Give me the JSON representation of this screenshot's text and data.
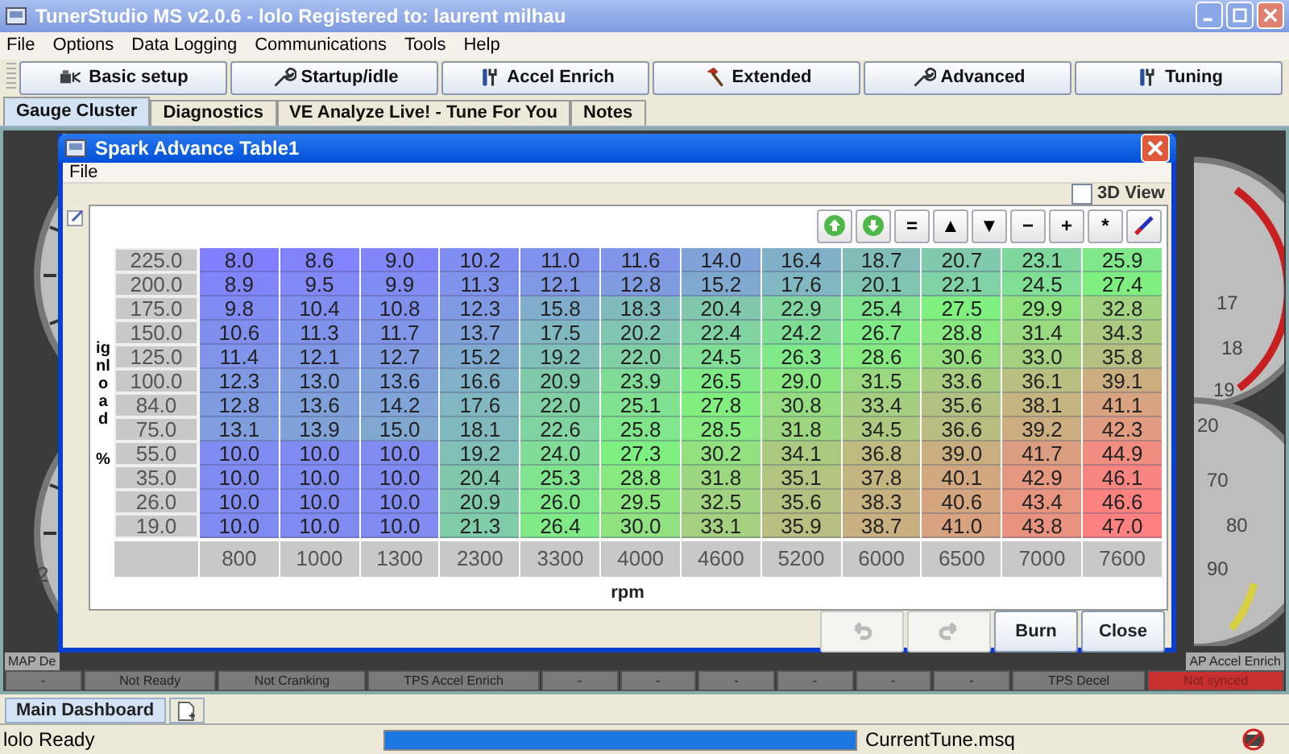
{
  "window": {
    "title": "TunerStudio MS v2.0.6 - lolo Registered to: laurent milhau"
  },
  "menu": [
    "File",
    "Options",
    "Data Logging",
    "Communications",
    "Tools",
    "Help"
  ],
  "toolbar": [
    {
      "label": "Basic setup",
      "kind": "plug"
    },
    {
      "label": "Startup/idle",
      "kind": "wrench"
    },
    {
      "label": "Accel Enrich",
      "kind": "tools"
    },
    {
      "label": "Extended",
      "kind": "hammer"
    },
    {
      "label": "Advanced",
      "kind": "wrench"
    },
    {
      "label": "Tuning",
      "kind": "tools"
    }
  ],
  "tabs": [
    {
      "label": "Gauge Cluster",
      "selected": true
    },
    {
      "label": "Diagnostics",
      "selected": false
    },
    {
      "label": "VE Analyze Live! - Tune For You",
      "selected": false
    },
    {
      "label": "Notes",
      "selected": false
    }
  ],
  "gauges": {
    "left_label": "2",
    "right_top_labels": [
      "17",
      "18",
      "19",
      "20"
    ],
    "right_bottom_labels": [
      "70",
      "80",
      "90"
    ]
  },
  "gauge_captions": {
    "left": "MAP De",
    "right": "AP Accel Enrich"
  },
  "indicators": [
    {
      "label": "-",
      "on": false
    },
    {
      "label": "Not Ready",
      "on": false
    },
    {
      "label": "Not Cranking",
      "on": false
    },
    {
      "label": "TPS Accel Enrich",
      "on": false
    },
    {
      "label": "-",
      "on": false
    },
    {
      "label": "-",
      "on": false
    },
    {
      "label": "-",
      "on": false
    },
    {
      "label": "-",
      "on": false
    },
    {
      "label": "-",
      "on": false
    },
    {
      "label": "-",
      "on": false
    },
    {
      "label": "TPS Decel",
      "on": false
    },
    {
      "label": "Not synced",
      "on": true
    }
  ],
  "dialog": {
    "title": "Spark Advance Table1",
    "menu": [
      "File"
    ],
    "view_3d": {
      "label": "3D View",
      "checked": false
    },
    "tools": [
      {
        "kind": "up"
      },
      {
        "kind": "down"
      },
      {
        "kind": "text",
        "label": "="
      },
      {
        "kind": "text",
        "label": "▲"
      },
      {
        "kind": "text",
        "label": "▼"
      },
      {
        "kind": "text",
        "label": "−"
      },
      {
        "kind": "text",
        "label": "+"
      },
      {
        "kind": "text",
        "label": "*"
      },
      {
        "kind": "pen"
      }
    ],
    "y_axis_label": "ignload",
    "y_axis_unit": "%",
    "x_axis_label": "rpm",
    "rows": [
      {
        "load": "225.0",
        "values": [
          "8.0",
          "8.6",
          "9.0",
          "10.2",
          "11.0",
          "11.6",
          "14.0",
          "16.4",
          "18.7",
          "20.7",
          "23.1",
          "25.9"
        ]
      },
      {
        "load": "200.0",
        "values": [
          "8.9",
          "9.5",
          "9.9",
          "11.3",
          "12.1",
          "12.8",
          "15.2",
          "17.6",
          "20.1",
          "22.1",
          "24.5",
          "27.4"
        ]
      },
      {
        "load": "175.0",
        "values": [
          "9.8",
          "10.4",
          "10.8",
          "12.3",
          "15.8",
          "18.3",
          "20.4",
          "22.9",
          "25.4",
          "27.5",
          "29.9",
          "32.8"
        ]
      },
      {
        "load": "150.0",
        "values": [
          "10.6",
          "11.3",
          "11.7",
          "13.7",
          "17.5",
          "20.2",
          "22.4",
          "24.2",
          "26.7",
          "28.8",
          "31.4",
          "34.3"
        ]
      },
      {
        "load": "125.0",
        "values": [
          "11.4",
          "12.1",
          "12.7",
          "15.2",
          "19.2",
          "22.0",
          "24.5",
          "26.3",
          "28.6",
          "30.6",
          "33.0",
          "35.8"
        ]
      },
      {
        "load": "100.0",
        "values": [
          "12.3",
          "13.0",
          "13.6",
          "16.6",
          "20.9",
          "23.9",
          "26.5",
          "29.0",
          "31.5",
          "33.6",
          "36.1",
          "39.1"
        ]
      },
      {
        "load": "84.0",
        "values": [
          "12.8",
          "13.6",
          "14.2",
          "17.6",
          "22.0",
          "25.1",
          "27.8",
          "30.8",
          "33.4",
          "35.6",
          "38.1",
          "41.1"
        ]
      },
      {
        "load": "75.0",
        "values": [
          "13.1",
          "13.9",
          "15.0",
          "18.1",
          "22.6",
          "25.8",
          "28.5",
          "31.8",
          "34.5",
          "36.6",
          "39.2",
          "42.3"
        ]
      },
      {
        "load": "55.0",
        "values": [
          "10.0",
          "10.0",
          "10.0",
          "19.2",
          "24.0",
          "27.3",
          "30.2",
          "34.1",
          "36.8",
          "39.0",
          "41.7",
          "44.9"
        ]
      },
      {
        "load": "35.0",
        "values": [
          "10.0",
          "10.0",
          "10.0",
          "20.4",
          "25.3",
          "28.8",
          "31.8",
          "35.1",
          "37.8",
          "40.1",
          "42.9",
          "46.1"
        ]
      },
      {
        "load": "26.0",
        "values": [
          "10.0",
          "10.0",
          "10.0",
          "20.9",
          "26.0",
          "29.5",
          "32.5",
          "35.6",
          "38.3",
          "40.6",
          "43.4",
          "46.6"
        ]
      },
      {
        "load": "19.0",
        "values": [
          "10.0",
          "10.0",
          "10.0",
          "21.3",
          "26.4",
          "30.0",
          "33.1",
          "35.9",
          "38.7",
          "41.0",
          "43.8",
          "47.0"
        ]
      }
    ],
    "rpm": [
      "800",
      "1000",
      "1300",
      "2300",
      "3300",
      "4000",
      "4600",
      "5200",
      "6000",
      "6500",
      "7000",
      "7600"
    ],
    "buttons": [
      {
        "kind": "undo",
        "disabled": true
      },
      {
        "kind": "redo",
        "disabled": true
      },
      {
        "kind": "text",
        "label": "Burn",
        "disabled": false
      },
      {
        "kind": "text",
        "label": "Close",
        "disabled": false
      }
    ]
  },
  "bottom_tabs": [
    {
      "label": "Main Dashboard",
      "selected": true
    }
  ],
  "status_bar": {
    "message": "lolo Ready",
    "progress": {
      "level": 1
    },
    "file": "CurrentTune.msq"
  }
}
